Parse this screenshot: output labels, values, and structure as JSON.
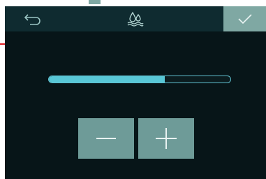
{
  "header": {
    "back_icon": "back-arrow-icon",
    "mode_icon": "water-drops-icon",
    "confirm_icon": "checkmark-icon"
  },
  "level": {
    "value_fraction": 0.64
  },
  "controls": {
    "decrease_icon": "minus-icon",
    "increase_icon": "plus-icon"
  },
  "colors": {
    "panel_bg": "#071518",
    "header_bg": "#0f2b30",
    "accent": "#58c7d6",
    "button_bg": "#6e9b98",
    "confirm_bg": "#7fa8a3",
    "pointer_arrow": "#e11b22"
  }
}
